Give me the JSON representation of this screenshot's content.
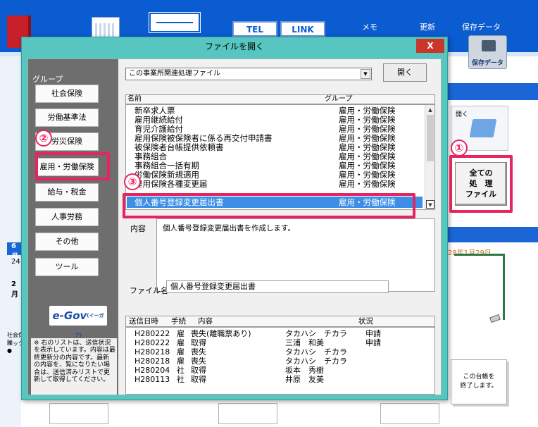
{
  "background": {
    "toolbar": {
      "tel_label": "TEL",
      "link_label": "LINK",
      "memo_label": "メモ",
      "update_label": "更新",
      "saved_data_label": "保存データ",
      "saved_data_icon_label": "保存データ"
    },
    "right_panel": {
      "open_label": "開く",
      "all_files_button": [
        "全ての",
        "処　理",
        "ファイル"
      ],
      "date_text": "28年1月29日",
      "ledger_text": [
        "この台帳を",
        "終了します。"
      ]
    },
    "left_fragments": [
      "6月",
      "24",
      "2月",
      "社会保険",
      "ニック ●"
    ]
  },
  "dialog": {
    "title": "ファイルを開く",
    "close_label": "X",
    "group_label": "グループ",
    "groups": [
      "社会保険",
      "労働基準法",
      "労災保険",
      "雇用・労働保険",
      "給与・税金",
      "人事労務",
      "その他",
      "ツール"
    ],
    "egov_label": "e-Gov",
    "egov_sub": "(イーガブ)",
    "note_text": "※ 右のリストは、送信状況を表示しています。内容は最終更新分の内容です。最新の内容を、覧になりたい場合は、送信済みリストで更新して取得してください。",
    "file_combo": {
      "value": "この事業所関連処理ファイル",
      "arrow": "▼"
    },
    "open_button": "開く",
    "list_columns": {
      "name": "名前",
      "group": "グループ"
    },
    "files": [
      {
        "name": "新卒求人票",
        "group": "雇用・労働保険"
      },
      {
        "name": "雇用継続給付",
        "group": "雇用・労働保険"
      },
      {
        "name": "育児介護給付",
        "group": "雇用・労働保険"
      },
      {
        "name": "雇用保険被保険者に係る再交付申請書",
        "group": "雇用・労働保険"
      },
      {
        "name": "被保険者台帳提供依頼書",
        "group": "雇用・労働保険"
      },
      {
        "name": "事務組合",
        "group": "雇用・労働保険"
      },
      {
        "name": "事務組合一括有期",
        "group": "雇用・労働保険"
      },
      {
        "name": "労働保険新規適用",
        "group": "雇用・労働保険"
      },
      {
        "name": "雇用保険各種変更届",
        "group": "雇用・労働保険"
      }
    ],
    "selected_file": {
      "name": "個人番号登録変更届出書",
      "group": "雇用・労働保険"
    },
    "scroll": {
      "up": "▲",
      "down": "▼"
    },
    "description_label": "内容",
    "description_text": "個人番号登録変更届出書を作成します。",
    "filename_label": "ファイル名",
    "filename_value": "個人番号登録変更届出書",
    "history_columns": {
      "date": "送信日時",
      "proc": "手続",
      "content": "内容",
      "status": "状況"
    },
    "history": [
      {
        "date": "H280222",
        "proc": "雇",
        "content": "喪失(離職票あり)",
        "person": "タカハシ　チカラ",
        "status": "申請"
      },
      {
        "date": "H280222",
        "proc": "雇",
        "content": "取得",
        "person": "三浦　和美",
        "status": "申請"
      },
      {
        "date": "H280218",
        "proc": "雇",
        "content": "喪失",
        "person": "タカハシ　チカラ",
        "status": ""
      },
      {
        "date": "H280218",
        "proc": "雇",
        "content": "喪失",
        "person": "タカハシ　チカラ",
        "status": ""
      },
      {
        "date": "H280204",
        "proc": "社",
        "content": "取得",
        "person": "坂本　秀樹",
        "status": ""
      },
      {
        "date": "H280113",
        "proc": "社",
        "content": "取得",
        "person": "井原　友美",
        "status": ""
      }
    ]
  },
  "annotations": {
    "step1": "①",
    "step2": "②",
    "step3": "③"
  }
}
